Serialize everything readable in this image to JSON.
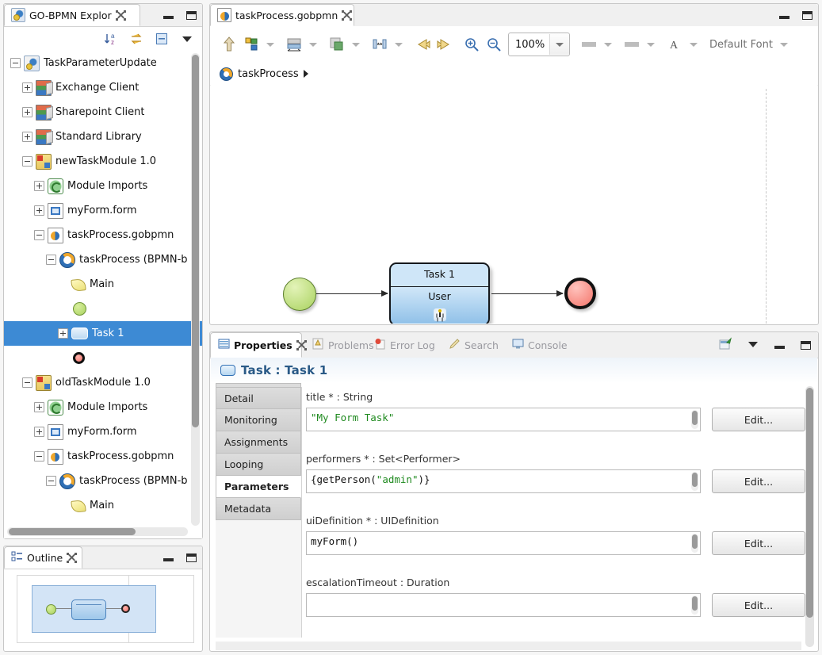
{
  "explorer": {
    "tab_label": "GO-BPMN Explor",
    "tab_icon": "bpmn-explorer-icon",
    "toolbar": [
      {
        "name": "sort-alphabetical-icon",
        "label": "Sort"
      },
      {
        "name": "link-with-editor-icon",
        "label": "Link with Editor"
      },
      {
        "name": "collapse-all-icon",
        "label": "Collapse All"
      },
      {
        "name": "view-menu-icon",
        "label": "View Menu"
      }
    ],
    "tree": [
      {
        "label": "TaskParameterUpdate",
        "depth": 0,
        "expander": "minus",
        "icon": "project-icon",
        "selected": false
      },
      {
        "label": "Exchange Client",
        "depth": 1,
        "expander": "plus",
        "icon": "library-icon",
        "selected": false
      },
      {
        "label": "Sharepoint Client",
        "depth": 1,
        "expander": "plus",
        "icon": "library-icon",
        "selected": false
      },
      {
        "label": "Standard Library",
        "depth": 1,
        "expander": "plus",
        "icon": "library-icon",
        "selected": false
      },
      {
        "label": "newTaskModule 1.0",
        "depth": 1,
        "expander": "minus",
        "icon": "module-icon",
        "selected": false
      },
      {
        "label": "Module Imports",
        "depth": 2,
        "expander": "plus",
        "icon": "module-imports-icon",
        "selected": false
      },
      {
        "label": "myForm.form",
        "depth": 2,
        "expander": "plus",
        "icon": "form-file-icon",
        "selected": false
      },
      {
        "label": "taskProcess.gobpmn",
        "depth": 2,
        "expander": "minus",
        "icon": "gobpmn-file-icon",
        "selected": false
      },
      {
        "label": "taskProcess (BPMN-b",
        "depth": 3,
        "expander": "minus",
        "icon": "process-icon",
        "selected": false
      },
      {
        "label": "Main",
        "depth": 4,
        "expander": "none",
        "icon": "main-pool-icon",
        "selected": false
      },
      {
        "label": "",
        "depth": 4,
        "expander": "none",
        "icon": "start-event-icon",
        "selected": false
      },
      {
        "label": "Task 1",
        "depth": 4,
        "expander": "plus",
        "icon": "task-icon",
        "selected": true
      },
      {
        "label": "",
        "depth": 4,
        "expander": "none",
        "icon": "end-event-icon",
        "selected": false
      },
      {
        "label": "oldTaskModule 1.0",
        "depth": 1,
        "expander": "minus",
        "icon": "module-icon",
        "selected": false
      },
      {
        "label": "Module Imports",
        "depth": 2,
        "expander": "plus",
        "icon": "module-imports-icon",
        "selected": false
      },
      {
        "label": "myForm.form",
        "depth": 2,
        "expander": "plus",
        "icon": "form-file-icon",
        "selected": false
      },
      {
        "label": "taskProcess.gobpmn",
        "depth": 2,
        "expander": "minus",
        "icon": "gobpmn-file-icon",
        "selected": false
      },
      {
        "label": "taskProcess (BPMN-b",
        "depth": 3,
        "expander": "minus",
        "icon": "process-icon",
        "selected": false
      },
      {
        "label": "Main",
        "depth": 4,
        "expander": "none",
        "icon": "main-pool-icon",
        "selected": false
      }
    ]
  },
  "outline": {
    "tab_label": "Outline",
    "tab_icon": "outline-icon"
  },
  "editor": {
    "tab_label": "taskProcess.gobpmn",
    "tab_icon": "gobpmn-file-icon",
    "breadcrumb": "taskProcess",
    "zoom_value": "100%",
    "font_label": "Default Font",
    "toolbar": [
      {
        "name": "export-icon"
      },
      {
        "name": "align-icon"
      },
      {
        "name": "match-width-icon"
      },
      {
        "name": "fill-color-icon"
      },
      {
        "name": "distribute-icon"
      },
      {
        "name": "undo-arrow-icon"
      },
      {
        "name": "redo-arrow-icon"
      },
      {
        "name": "zoom-in-icon"
      },
      {
        "name": "zoom-out-icon"
      },
      {
        "name": "line-style-icon"
      },
      {
        "name": "line-width-icon"
      },
      {
        "name": "font-color-icon"
      }
    ],
    "diagram": {
      "start_event": "start-event",
      "task_name": "Task 1",
      "task_type": "User",
      "task_glyph": "user-actor-icon",
      "end_event": "end-event"
    }
  },
  "properties": {
    "tabs": [
      {
        "label": "Properties",
        "icon": "properties-icon",
        "active": true
      },
      {
        "label": "Problems",
        "icon": "problems-icon",
        "active": false
      },
      {
        "label": "Error Log",
        "icon": "error-log-icon",
        "active": false
      },
      {
        "label": "Search",
        "icon": "search-icon",
        "active": false
      },
      {
        "label": "Console",
        "icon": "console-icon",
        "active": false
      }
    ],
    "actions": [
      {
        "name": "pin-view-icon"
      },
      {
        "name": "view-menu-icon"
      },
      {
        "name": "minimize-icon"
      },
      {
        "name": "maximize-icon"
      }
    ],
    "title": "Task : Task 1",
    "title_icon": "task-icon",
    "side_tabs": [
      {
        "label": "Detail",
        "active": false
      },
      {
        "label": "Monitoring",
        "active": false
      },
      {
        "label": "Assignments",
        "active": false
      },
      {
        "label": "Looping",
        "active": false
      },
      {
        "label": "Parameters",
        "active": true
      },
      {
        "label": "Metadata",
        "active": false
      }
    ],
    "fields": [
      {
        "label": "title * : String",
        "value": "\"My Form Task\"",
        "value_kind": "string",
        "button": "Edit..."
      },
      {
        "label": "performers * : Set<Performer>",
        "value": "{getPerson(\"admin\")}",
        "value_kind": "expression",
        "button": "Edit..."
      },
      {
        "label": "uiDefinition * : UIDefinition",
        "value": "myForm()",
        "value_kind": "expression",
        "button": "Edit..."
      },
      {
        "label": "escalationTimeout : Duration",
        "value": "",
        "value_kind": "empty",
        "button": "Edit..."
      }
    ]
  },
  "colors": {
    "selection_blue": "#3d8ad4",
    "title_blue": "#2a5a87",
    "string_green": "#1f8a1f",
    "task_fill": "#8fc0e8",
    "start_green": "#a9d25f",
    "end_red": "#f4756b"
  }
}
